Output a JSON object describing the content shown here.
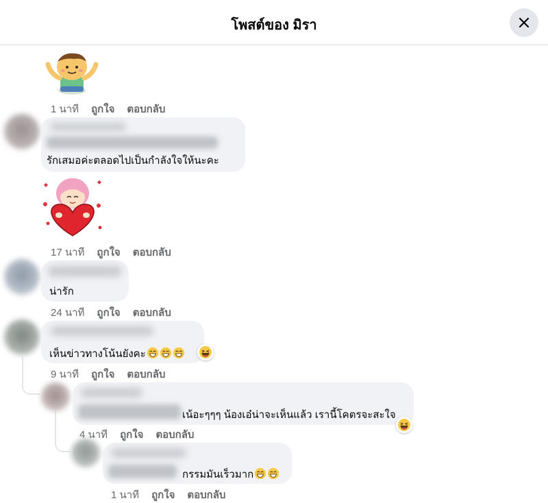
{
  "header": {
    "title": "โพสต์ของ มิรา"
  },
  "icons": {
    "close": "close-icon",
    "laugh": "laughing-emoji-icon",
    "grin": "grinning-emoji-icon"
  },
  "comments": [
    {
      "time": "1 นาที",
      "like": "ถูกใจ",
      "reply": "ตอบกลับ",
      "sticker": "boy-waving-sticker"
    },
    {
      "text": "รักเสมอค่ะตลอดไปเป็นกำลังใจให้นะคะ"
    },
    {
      "time": "17 นาที",
      "like": "ถูกใจ",
      "reply": "ตอบกลับ",
      "sticker": "girl-heart-sticker"
    },
    {
      "text": "น่ารัก",
      "time": "24 นาที",
      "like": "ถูกใจ",
      "reply": "ตอบกลับ"
    },
    {
      "text": "เห็นข่าวทางโน้นยังคะ",
      "time": "9 นาที",
      "like": "ถูกใจ",
      "reply": "ตอบกลับ"
    }
  ],
  "replies": [
    {
      "text": "เน้อะๆๆๆ น้องเอ๋น่าจะเห็นแล้ว เรานี้โคตรจะสะใจ",
      "time": "4 นาที",
      "like": "ถูกใจ",
      "reply": "ตอบกลับ"
    },
    {
      "text": "กรรมมันเร็วมาก",
      "time": "1 นาที",
      "like": "ถูกใจ",
      "reply": "ตอบกลับ"
    }
  ]
}
